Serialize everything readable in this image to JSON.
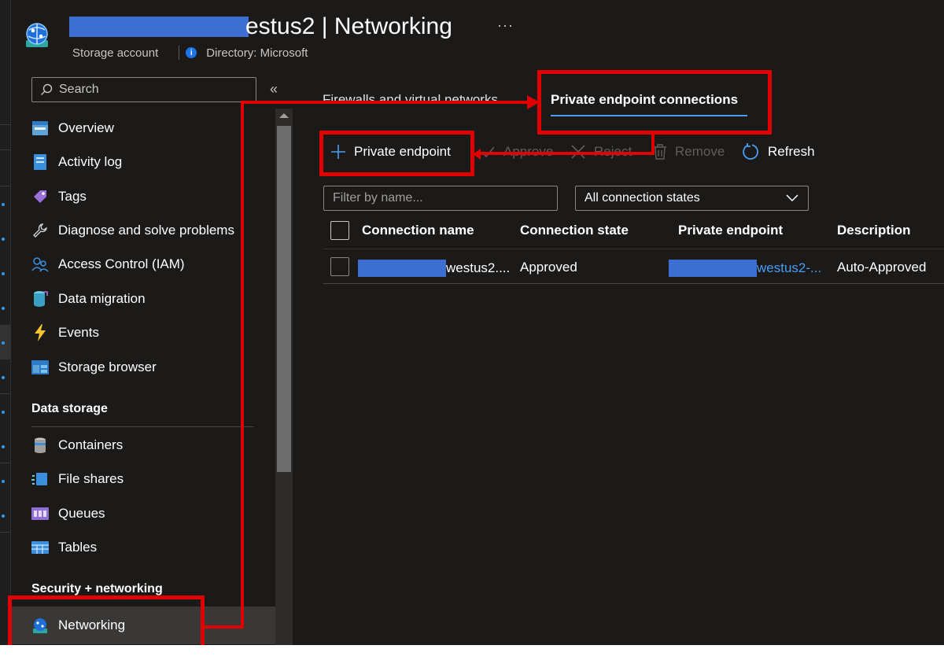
{
  "header": {
    "title": "estus2 | Networking",
    "more": "···",
    "resource_type": "Storage account",
    "directory": "Directory: Microsoft"
  },
  "sidebar": {
    "search_placeholder": "Search",
    "collapse": "«",
    "items": [
      {
        "label": "Overview",
        "icon": "overview-icon"
      },
      {
        "label": "Activity log",
        "icon": "activity-log-icon"
      },
      {
        "label": "Tags",
        "icon": "tag-icon"
      },
      {
        "label": "Diagnose and solve problems",
        "icon": "wrench-icon"
      },
      {
        "label": "Access Control (IAM)",
        "icon": "people-icon"
      },
      {
        "label": "Data migration",
        "icon": "data-migration-icon"
      },
      {
        "label": "Events",
        "icon": "lightning-icon"
      },
      {
        "label": "Storage browser",
        "icon": "storage-browser-icon"
      }
    ],
    "groups": [
      {
        "title": "Data storage",
        "items": [
          {
            "label": "Containers",
            "icon": "container-icon"
          },
          {
            "label": "File shares",
            "icon": "file-share-icon"
          },
          {
            "label": "Queues",
            "icon": "queue-icon"
          },
          {
            "label": "Tables",
            "icon": "table-icon"
          }
        ]
      },
      {
        "title": "Security + networking",
        "items": [
          {
            "label": "Networking",
            "icon": "networking-icon",
            "selected": true
          }
        ]
      }
    ]
  },
  "tabs": [
    {
      "label": "Firewalls and virtual networks",
      "active": false
    },
    {
      "label": "Private endpoint connections",
      "active": true
    }
  ],
  "toolbar": {
    "add": "Private endpoint",
    "approve": "Approve",
    "reject": "Reject",
    "remove": "Remove",
    "refresh": "Refresh"
  },
  "filters": {
    "name_placeholder": "Filter by name...",
    "state_selected": "All connection states"
  },
  "table": {
    "columns": [
      "Connection name",
      "Connection state",
      "Private endpoint",
      "Description"
    ],
    "rows": [
      {
        "connection_name": "westus2....",
        "connection_state": "Approved",
        "private_endpoint": "westus2-...",
        "description": "Auto-Approved"
      }
    ]
  },
  "colors": {
    "background": "#1b1a19",
    "accent": "#479ef5",
    "annotation": "#e00000",
    "redaction": "#3c6ed4"
  }
}
